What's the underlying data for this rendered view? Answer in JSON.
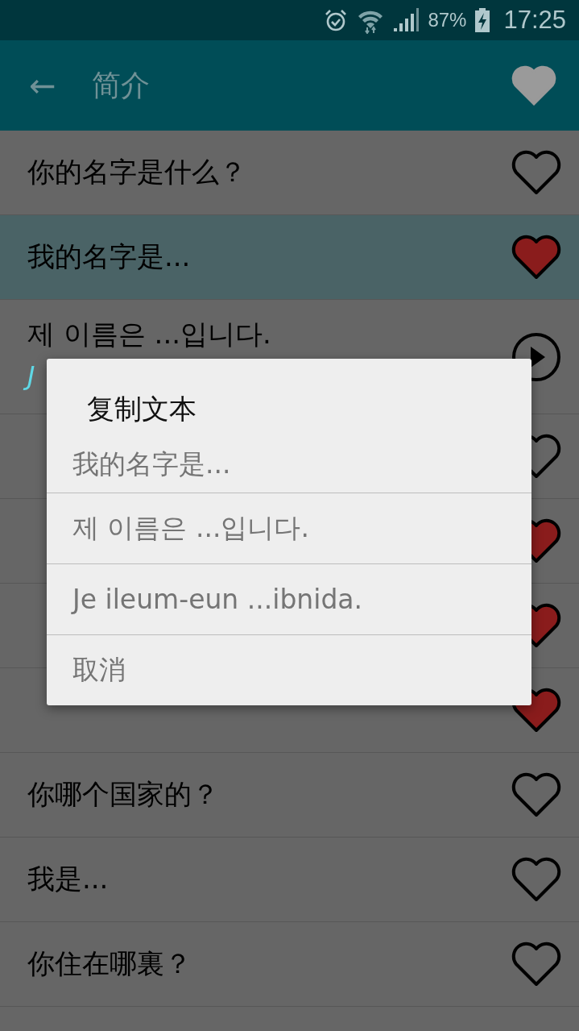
{
  "status_bar": {
    "battery": "87%",
    "time": "17:25"
  },
  "app_bar": {
    "back": "←",
    "title": "简介",
    "favorite": true
  },
  "phrases": [
    {
      "text": "你的名字是什么？",
      "selected": false,
      "kind": "heart",
      "favorite": false
    },
    {
      "text": "我的名字是...",
      "selected": true,
      "kind": "heart",
      "favorite": true
    },
    {
      "text": "제 이름은 ...입니다.",
      "subtitle": "J",
      "selected": false,
      "kind": "play"
    },
    {
      "selected": false,
      "kind": "heart",
      "favorite": false
    },
    {
      "selected": false,
      "kind": "heart",
      "favorite": true
    },
    {
      "selected": false,
      "kind": "heart",
      "favorite": true
    },
    {
      "selected": false,
      "kind": "heart",
      "favorite": true
    },
    {
      "text": "你哪个国家的？",
      "selected": false,
      "kind": "heart",
      "favorite": false
    },
    {
      "text": "我是...",
      "selected": false,
      "kind": "heart",
      "favorite": false
    },
    {
      "text": "你住在哪裏？",
      "selected": false,
      "kind": "heart",
      "favorite": false
    }
  ],
  "dialog": {
    "title": "复制文本",
    "options": [
      "我的名字是...",
      "제 이름은 ...입니다.",
      "Je ileum-eun ...ibnida.",
      "取消"
    ]
  }
}
